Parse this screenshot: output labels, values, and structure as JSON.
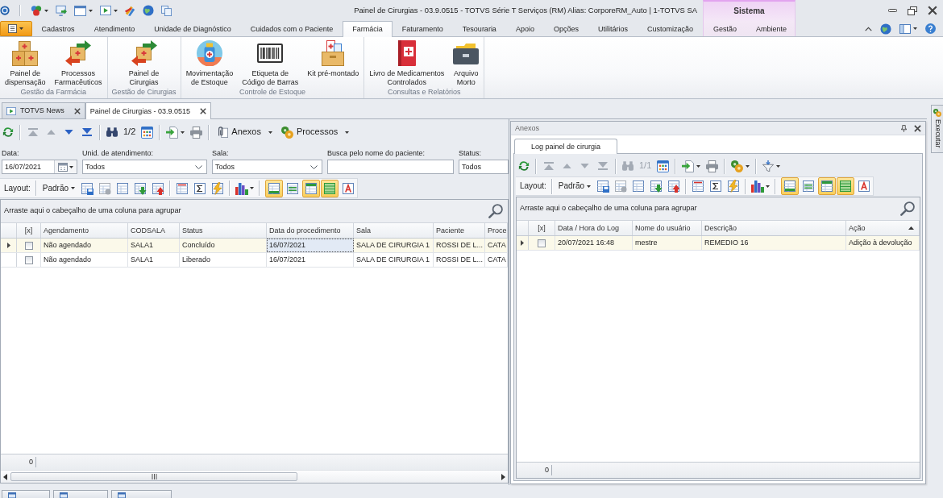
{
  "title_bar": {
    "title": "Painel de Cirurgias - 03.9.0515 - TOTVS Série T Serviços (RM) Alias: CorporeRM_Auto | 1-TOTVS SA"
  },
  "ribbon": {
    "tabs": [
      {
        "label": "Cadastros",
        "selected": false
      },
      {
        "label": "Atendimento",
        "selected": false
      },
      {
        "label": "Unidade de Diagnóstico",
        "selected": false
      },
      {
        "label": "Cuidados com o Paciente",
        "selected": false
      },
      {
        "label": "Farmácia",
        "selected": true
      },
      {
        "label": "Faturamento",
        "selected": false
      },
      {
        "label": "Tesouraria",
        "selected": false
      },
      {
        "label": "Apoio",
        "selected": false
      },
      {
        "label": "Opções",
        "selected": false
      },
      {
        "label": "Utilitários",
        "selected": false
      },
      {
        "label": "Customização",
        "selected": false
      }
    ],
    "context_group": {
      "label": "Sistema",
      "tabs": [
        {
          "label": "Gestão",
          "selected": false
        },
        {
          "label": "Ambiente",
          "selected": false
        }
      ]
    },
    "groups": [
      {
        "label": "Gestão da Farmácia",
        "buttons": [
          "Painel de\ndispensação",
          "Processos\nFarmacêuticos"
        ]
      },
      {
        "label": "Gestão de Cirurgias",
        "buttons": [
          "Painel de\nCirurgias"
        ]
      },
      {
        "label": "Controle de Estoque",
        "buttons": [
          "Movimentação\nde Estoque",
          "Etiqueta de\nCódigo de Barras",
          "Kit pré-montado"
        ]
      },
      {
        "label": "Consultas e Relatórios",
        "buttons": [
          "Livro de Medicamentos\nControlados",
          "Arquivo\nMorto"
        ]
      }
    ]
  },
  "document_tabs": [
    {
      "label": "TOTVS News",
      "selected": false
    },
    {
      "label": "Painel de Cirurgias - 03.9.0515",
      "selected": true
    }
  ],
  "main_panel": {
    "toolbar": {
      "nav": [
        {
          "disabled": true
        },
        {
          "disabled": true
        },
        {
          "disabled": false
        },
        {
          "disabled": false
        }
      ],
      "pager": {
        "text": "1/2",
        "disabled": false
      },
      "menus": [
        "Anexos",
        "Processos"
      ]
    },
    "filters": [
      {
        "label": "Data:",
        "kind": "date",
        "value": "16/07/2021"
      },
      {
        "label": "Unid. de atendimento:",
        "kind": "combo",
        "value": "Todos"
      },
      {
        "label": "Sala:",
        "kind": "combo",
        "value": "Todos"
      },
      {
        "label": "Busca pelo nome do paciente:",
        "kind": "text"
      },
      {
        "label": "Status:",
        "kind": "text",
        "value": "Todos"
      }
    ],
    "layout_toolbar": {
      "label": "Layout:",
      "preset": "Padrão",
      "toggles": [
        {
          "on": true
        },
        {
          "on": false
        },
        {
          "on": true
        },
        {
          "on": true
        },
        {
          "on": false
        }
      ]
    },
    "group_hint": "Arraste aqui o cabeçalho de uma coluna para agrupar",
    "grid": {
      "checkbox_header": "[x]",
      "columns": [
        {
          "label": "Agendamento",
          "sorted": false
        },
        {
          "label": "CODSALA",
          "sorted": false
        },
        {
          "label": "Status",
          "sorted": false
        },
        {
          "label": "Data do procedimento",
          "sorted": false
        },
        {
          "label": "Sala",
          "sorted": false
        },
        {
          "label": "Paciente",
          "sorted": false
        },
        {
          "label": "Proce",
          "sorted": false
        }
      ],
      "rows": [
        {
          "selected": true,
          "checked": false,
          "cells": [
            {
              "text": "Não agendado",
              "focused": false
            },
            {
              "text": "SALA1",
              "focused": false
            },
            {
              "text": "Concluído",
              "focused": false
            },
            {
              "text": "16/07/2021",
              "focused": true
            },
            {
              "text": "SALA DE CIRURGIA 1",
              "focused": false
            },
            {
              "text": "ROSSI DE L...",
              "focused": false
            },
            {
              "text": "CATA",
              "focused": false
            }
          ]
        },
        {
          "selected": false,
          "checked": false,
          "cells": [
            {
              "text": "Não agendado",
              "focused": false
            },
            {
              "text": "SALA1",
              "focused": false
            },
            {
              "text": "Liberado",
              "focused": false
            },
            {
              "text": "16/07/2021",
              "focused": false
            },
            {
              "text": "SALA DE CIRURGIA 1",
              "focused": false
            },
            {
              "text": "ROSSI DE L...",
              "focused": false
            },
            {
              "text": "CATA",
              "focused": false
            }
          ]
        }
      ],
      "footer": "0"
    }
  },
  "attachments_panel": {
    "title": "Anexos",
    "tabs": [
      {
        "label": "Log painel de cirurgia",
        "selected": true
      }
    ],
    "toolbar": {
      "nav": [
        {
          "disabled": true
        },
        {
          "disabled": true
        },
        {
          "disabled": true
        },
        {
          "disabled": true
        }
      ],
      "pager": {
        "text": "1/1",
        "disabled": true
      }
    },
    "layout_toolbar": {
      "label": "Layout:",
      "preset": "Padrão",
      "toggles": [
        {
          "on": true
        },
        {
          "on": false
        },
        {
          "on": true
        },
        {
          "on": true
        },
        {
          "on": false
        }
      ]
    },
    "group_hint": "Arraste aqui o cabeçalho de uma coluna para agrupar",
    "grid": {
      "checkbox_header": "[x]",
      "columns": [
        {
          "label": "Data / Hora do Log",
          "sorted": false
        },
        {
          "label": "Nome do usuário",
          "sorted": false
        },
        {
          "label": "Descrição",
          "sorted": false
        },
        {
          "label": "Ação",
          "sorted": true
        }
      ],
      "rows": [
        {
          "selected": true,
          "checked": false,
          "cells": [
            {
              "text": "20/07/2021 16:48",
              "focused": false
            },
            {
              "text": "mestre",
              "focused": false
            },
            {
              "text": "REMEDIO 16",
              "focused": false
            },
            {
              "text": "Adição à devolução",
              "focused": false
            }
          ]
        }
      ],
      "footer": "0"
    }
  },
  "dock_tab": "Executar"
}
